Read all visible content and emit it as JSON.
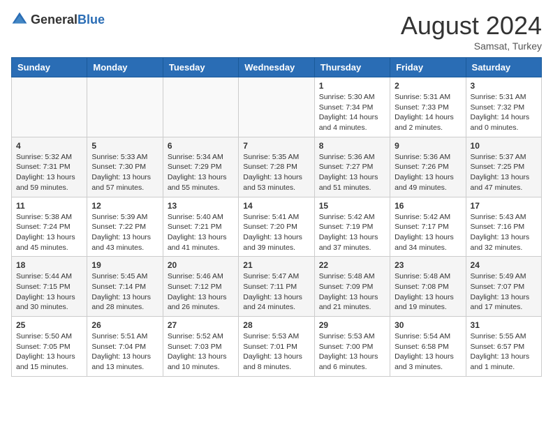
{
  "header": {
    "logo_general": "General",
    "logo_blue": "Blue",
    "month_year": "August 2024",
    "location": "Samsat, Turkey"
  },
  "days_of_week": [
    "Sunday",
    "Monday",
    "Tuesday",
    "Wednesday",
    "Thursday",
    "Friday",
    "Saturday"
  ],
  "weeks": [
    [
      {
        "day": "",
        "info": ""
      },
      {
        "day": "",
        "info": ""
      },
      {
        "day": "",
        "info": ""
      },
      {
        "day": "",
        "info": ""
      },
      {
        "day": "1",
        "info": "Sunrise: 5:30 AM\nSunset: 7:34 PM\nDaylight: 14 hours\nand 4 minutes."
      },
      {
        "day": "2",
        "info": "Sunrise: 5:31 AM\nSunset: 7:33 PM\nDaylight: 14 hours\nand 2 minutes."
      },
      {
        "day": "3",
        "info": "Sunrise: 5:31 AM\nSunset: 7:32 PM\nDaylight: 14 hours\nand 0 minutes."
      }
    ],
    [
      {
        "day": "4",
        "info": "Sunrise: 5:32 AM\nSunset: 7:31 PM\nDaylight: 13 hours\nand 59 minutes."
      },
      {
        "day": "5",
        "info": "Sunrise: 5:33 AM\nSunset: 7:30 PM\nDaylight: 13 hours\nand 57 minutes."
      },
      {
        "day": "6",
        "info": "Sunrise: 5:34 AM\nSunset: 7:29 PM\nDaylight: 13 hours\nand 55 minutes."
      },
      {
        "day": "7",
        "info": "Sunrise: 5:35 AM\nSunset: 7:28 PM\nDaylight: 13 hours\nand 53 minutes."
      },
      {
        "day": "8",
        "info": "Sunrise: 5:36 AM\nSunset: 7:27 PM\nDaylight: 13 hours\nand 51 minutes."
      },
      {
        "day": "9",
        "info": "Sunrise: 5:36 AM\nSunset: 7:26 PM\nDaylight: 13 hours\nand 49 minutes."
      },
      {
        "day": "10",
        "info": "Sunrise: 5:37 AM\nSunset: 7:25 PM\nDaylight: 13 hours\nand 47 minutes."
      }
    ],
    [
      {
        "day": "11",
        "info": "Sunrise: 5:38 AM\nSunset: 7:24 PM\nDaylight: 13 hours\nand 45 minutes."
      },
      {
        "day": "12",
        "info": "Sunrise: 5:39 AM\nSunset: 7:22 PM\nDaylight: 13 hours\nand 43 minutes."
      },
      {
        "day": "13",
        "info": "Sunrise: 5:40 AM\nSunset: 7:21 PM\nDaylight: 13 hours\nand 41 minutes."
      },
      {
        "day": "14",
        "info": "Sunrise: 5:41 AM\nSunset: 7:20 PM\nDaylight: 13 hours\nand 39 minutes."
      },
      {
        "day": "15",
        "info": "Sunrise: 5:42 AM\nSunset: 7:19 PM\nDaylight: 13 hours\nand 37 minutes."
      },
      {
        "day": "16",
        "info": "Sunrise: 5:42 AM\nSunset: 7:17 PM\nDaylight: 13 hours\nand 34 minutes."
      },
      {
        "day": "17",
        "info": "Sunrise: 5:43 AM\nSunset: 7:16 PM\nDaylight: 13 hours\nand 32 minutes."
      }
    ],
    [
      {
        "day": "18",
        "info": "Sunrise: 5:44 AM\nSunset: 7:15 PM\nDaylight: 13 hours\nand 30 minutes."
      },
      {
        "day": "19",
        "info": "Sunrise: 5:45 AM\nSunset: 7:14 PM\nDaylight: 13 hours\nand 28 minutes."
      },
      {
        "day": "20",
        "info": "Sunrise: 5:46 AM\nSunset: 7:12 PM\nDaylight: 13 hours\nand 26 minutes."
      },
      {
        "day": "21",
        "info": "Sunrise: 5:47 AM\nSunset: 7:11 PM\nDaylight: 13 hours\nand 24 minutes."
      },
      {
        "day": "22",
        "info": "Sunrise: 5:48 AM\nSunset: 7:09 PM\nDaylight: 13 hours\nand 21 minutes."
      },
      {
        "day": "23",
        "info": "Sunrise: 5:48 AM\nSunset: 7:08 PM\nDaylight: 13 hours\nand 19 minutes."
      },
      {
        "day": "24",
        "info": "Sunrise: 5:49 AM\nSunset: 7:07 PM\nDaylight: 13 hours\nand 17 minutes."
      }
    ],
    [
      {
        "day": "25",
        "info": "Sunrise: 5:50 AM\nSunset: 7:05 PM\nDaylight: 13 hours\nand 15 minutes."
      },
      {
        "day": "26",
        "info": "Sunrise: 5:51 AM\nSunset: 7:04 PM\nDaylight: 13 hours\nand 13 minutes."
      },
      {
        "day": "27",
        "info": "Sunrise: 5:52 AM\nSunset: 7:03 PM\nDaylight: 13 hours\nand 10 minutes."
      },
      {
        "day": "28",
        "info": "Sunrise: 5:53 AM\nSunset: 7:01 PM\nDaylight: 13 hours\nand 8 minutes."
      },
      {
        "day": "29",
        "info": "Sunrise: 5:53 AM\nSunset: 7:00 PM\nDaylight: 13 hours\nand 6 minutes."
      },
      {
        "day": "30",
        "info": "Sunrise: 5:54 AM\nSunset: 6:58 PM\nDaylight: 13 hours\nand 3 minutes."
      },
      {
        "day": "31",
        "info": "Sunrise: 5:55 AM\nSunset: 6:57 PM\nDaylight: 13 hours\nand 1 minute."
      }
    ]
  ]
}
